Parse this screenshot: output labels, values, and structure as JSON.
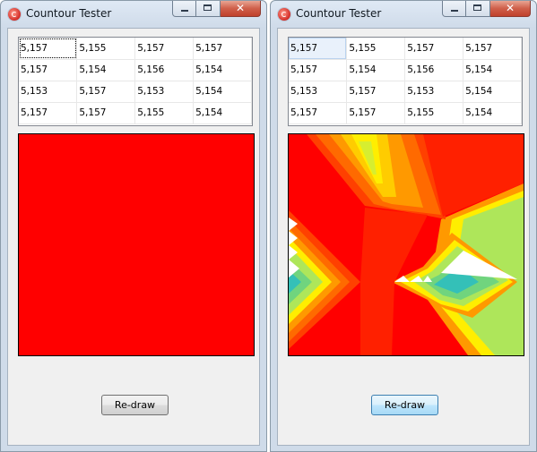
{
  "windows": [
    {
      "title": "Countour Tester",
      "close_glyph": "✕",
      "grid": [
        [
          "5,157",
          "5,155",
          "5,157",
          "5,157"
        ],
        [
          "5,157",
          "5,154",
          "5,156",
          "5,154"
        ],
        [
          "5,153",
          "5,157",
          "5,153",
          "5,154"
        ],
        [
          "5,157",
          "5,157",
          "5,155",
          "5,154"
        ]
      ],
      "canvas_state": "solid-red",
      "redraw_label": "Re-draw"
    },
    {
      "title": "Countour Tester",
      "close_glyph": "✕",
      "grid": [
        [
          "5,157",
          "5,155",
          "5,157",
          "5,157"
        ],
        [
          "5,157",
          "5,154",
          "5,156",
          "5,154"
        ],
        [
          "5,153",
          "5,157",
          "5,153",
          "5,154"
        ],
        [
          "5,157",
          "5,157",
          "5,155",
          "5,154"
        ]
      ],
      "canvas_state": "contour-plot",
      "redraw_label": "Re-draw"
    }
  ],
  "colors": {
    "red": "#ff0000",
    "red_orange": "#ff4000",
    "orange_red": "#ff6a00",
    "orange": "#ff9900",
    "amber": "#ffcc00",
    "yellow": "#ffee00",
    "yellow_green": "#d6ee30",
    "light_green": "#aee65a",
    "green": "#70d47e",
    "teal": "#34c0b8",
    "white": "#ffffff"
  }
}
